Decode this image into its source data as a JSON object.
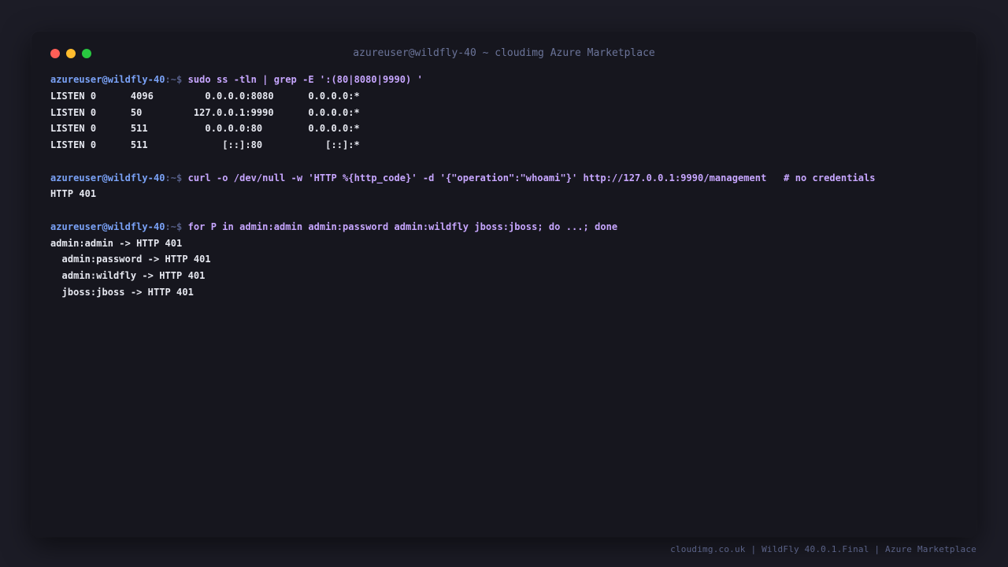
{
  "window": {
    "title": "azureuser@wildfly-40 ~ cloudimg Azure Marketplace"
  },
  "prompt": {
    "user_host": "azureuser@wildfly-40",
    "path_symbol": ":~$ "
  },
  "session": {
    "cmd1": "sudo ss -tln | grep -E ':(80|8080|9990) '",
    "cmd1_output": [
      "LISTEN 0      4096         0.0.0.0:8080      0.0.0.0:*",
      "LISTEN 0      50         127.0.0.1:9990      0.0.0.0:*",
      "LISTEN 0      511          0.0.0.0:80        0.0.0.0:*",
      "LISTEN 0      511             [::]:80           [::]:*"
    ],
    "cmd2": "curl -o /dev/null -w 'HTTP %{http_code}' -d '{\"operation\":\"whoami\"}' http://127.0.0.1:9990/management   # no credentials",
    "cmd2_output": [
      "HTTP 401"
    ],
    "cmd3": "for P in admin:admin admin:password admin:wildfly jboss:jboss; do ...; done",
    "cmd3_output": [
      "admin:admin -> HTTP 401",
      "  admin:password -> HTTP 401",
      "  admin:wildfly -> HTTP 401",
      "  jboss:jboss -> HTTP 401"
    ]
  },
  "footer": {
    "text": "cloudimg.co.uk | WildFly 40.0.1.Final | Azure Marketplace"
  },
  "colors": {
    "page_background": "#1c1c26",
    "terminal_background": "#16161e",
    "prompt_user": "#7aa2f7",
    "command": "#c7a6ff",
    "output": "#e6e8f0",
    "close_button": "#ff5f57",
    "minimize_button": "#febc2e",
    "maximize_button": "#28c840"
  },
  "icons": {
    "close": "close-dot-icon",
    "minimize": "minimize-dot-icon",
    "maximize": "maximize-dot-icon"
  }
}
